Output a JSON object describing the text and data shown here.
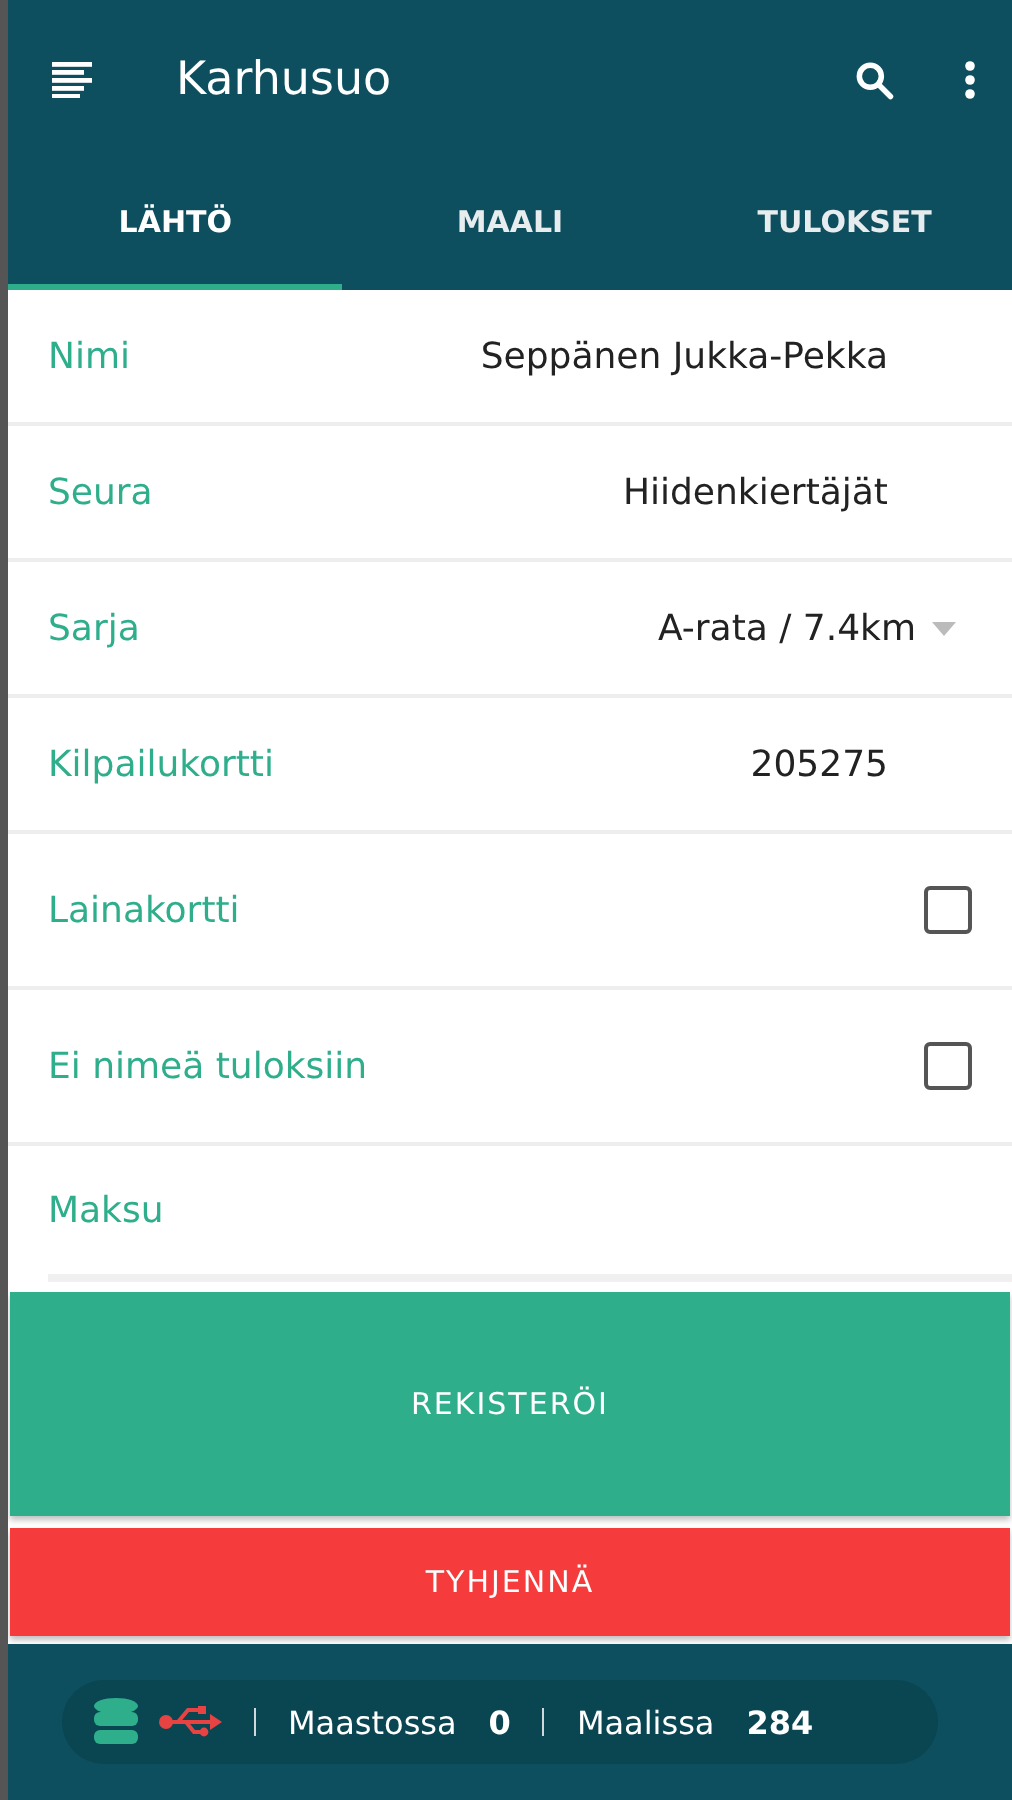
{
  "app_bar": {
    "title": "Karhusuo"
  },
  "tabs": [
    {
      "label": "LÄHTÖ",
      "selected": true
    },
    {
      "label": "MAALI",
      "selected": false
    },
    {
      "label": "TULOKSET",
      "selected": false
    }
  ],
  "form": [
    {
      "kind": "text",
      "label": "Nimi",
      "value": "Seppänen Jukka-Pekka"
    },
    {
      "kind": "text",
      "label": "Seura",
      "value": "Hiidenkiertäjät"
    },
    {
      "kind": "select",
      "label": "Sarja",
      "value": "A-rata / 7.4km"
    },
    {
      "kind": "text",
      "label": "Kilpailukortti",
      "value": "205275"
    },
    {
      "kind": "checkbox",
      "label": "Lainakortti",
      "checked": false
    },
    {
      "kind": "checkbox",
      "label": "Ei nimeä tuloksiin",
      "checked": false
    },
    {
      "kind": "field",
      "label": "Maksu"
    }
  ],
  "buttons": [
    {
      "kind": "primary",
      "label": "REKISTERÖI"
    },
    {
      "kind": "danger",
      "label": "TYHJENNÄ"
    }
  ],
  "status_bar": {
    "counts": [
      {
        "label": "Maastossa",
        "value": "0"
      },
      {
        "label": "Maalissa",
        "value": "284"
      }
    ]
  }
}
